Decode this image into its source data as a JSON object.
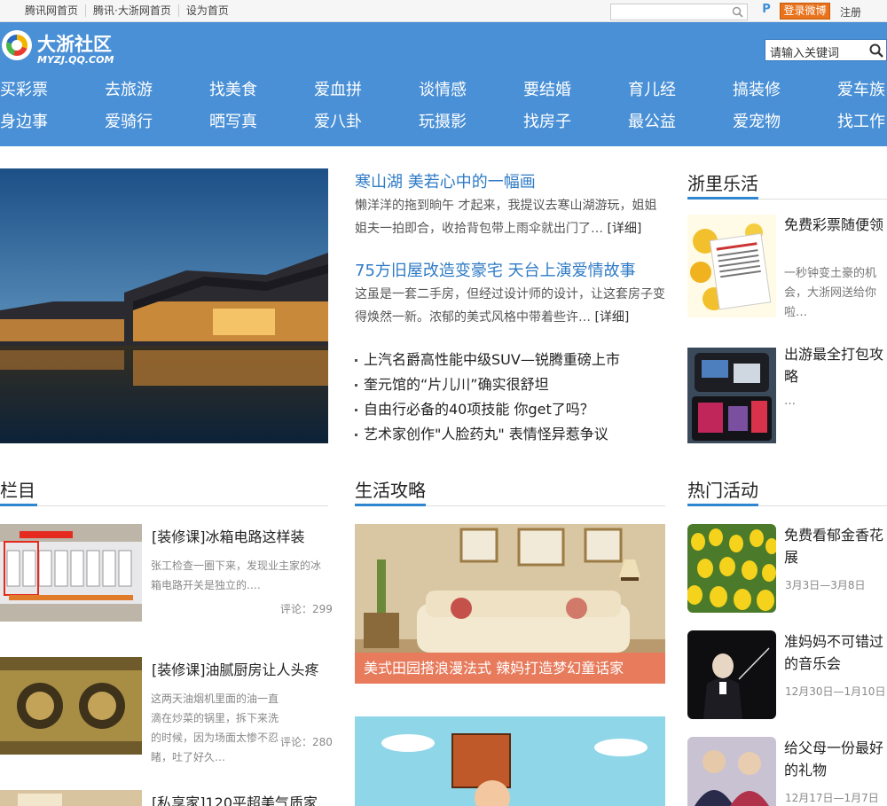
{
  "topbar": {
    "links": [
      "腾讯网首页",
      "腾讯·大浙网首页",
      "设为首页"
    ],
    "weibo_login": "登录微博",
    "register": "注册",
    "p_label": "P"
  },
  "header": {
    "logo_cn": "大浙社区",
    "logo_en": "MYZJ.QQ.COM",
    "search_placeholder": "请输入关键词",
    "nav_row1": [
      "买彩票",
      "去旅游",
      "找美食",
      "爱血拼",
      "谈情感",
      "要结婚",
      "育儿经",
      "搞装修",
      "爱车族"
    ],
    "nav_row2": [
      "身边事",
      "爱骑行",
      "晒写真",
      "爱八卦",
      "玩摄影",
      "找房子",
      "最公益",
      "爱宠物",
      "找工作"
    ]
  },
  "headline": {
    "items": [
      {
        "title": "寒山湖 美若心中的一幅画",
        "desc": "懒洋洋的拖到晌午 才起来，我提议去寒山湖游玩，姐姐姐夫一拍即合，收拾背包带上雨伞就出门了…",
        "more": "[详细]"
      },
      {
        "title": "75方旧屋改造变豪宅 天台上演爱情故事",
        "desc": "这虽是一套二手房，但经过设计师的设计，让这套房子变得焕然一新。浓郁的美式风格中带着些许…",
        "more": "[详细]"
      }
    ],
    "news": [
      "上汽名爵高性能中级SUV—锐腾重磅上市",
      "奎元馆的“片儿川”确实很舒坦",
      "自由行必备的40项技能 你get了吗？",
      "艺术家创作\"人脸药丸\" 表情怪异惹争议"
    ]
  },
  "zheli": {
    "title": "浙里乐活",
    "items": [
      {
        "title": "免费彩票随便领",
        "desc": "一秒钟变土豪的机会，大浙网送给你啦…"
      },
      {
        "title": "出游最全打包攻略",
        "desc": "…"
      }
    ]
  },
  "lanmu": {
    "title": "栏目",
    "items": [
      {
        "title": "[装修课]冰箱电路这样装",
        "desc": "张工检查一圈下来，发现业主家的冰箱电路开关是独立的.…",
        "comments": "评论：299"
      },
      {
        "title": "[装修课]油腻厨房让人头疼",
        "desc": "这两天油烟机里面的油一直滴在炒菜的锅里，拆下来洗的时候，因为场面太惨不忍睹，吐了好久…",
        "comments": "评论：280"
      },
      {
        "title": "[私享家]120平超美气质家"
      }
    ]
  },
  "life": {
    "title": "生活攻略",
    "caption": "美式田园搭浪漫法式 辣妈打造梦幻童话家"
  },
  "hot": {
    "title": "热门活动",
    "items": [
      {
        "title": "免费看郁金香花展",
        "date": "3月3日—3月8日"
      },
      {
        "title": "准妈妈不可错过的音乐会",
        "date": "12月30日—1月10日"
      },
      {
        "title": "给父母一份最好的礼物",
        "date": "12月17日—1月7日"
      }
    ]
  }
}
